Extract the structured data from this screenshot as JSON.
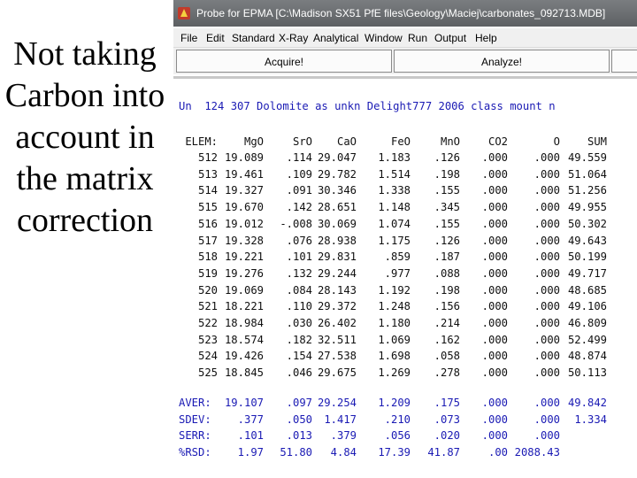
{
  "caption": "Not taking Carbon into account in the matrix correction",
  "window": {
    "title": "Probe for EPMA [C:\\Madison SX51 PfE files\\Geology\\Maciej\\carbonates_092713.MDB]"
  },
  "menu": [
    "File",
    "Edit",
    "Standard",
    "X-Ray",
    "Analytical",
    "Window",
    "Run",
    "Output",
    "Help"
  ],
  "toolbar": {
    "acquire_label": "Acquire!",
    "analyze_label": "Analyze!"
  },
  "log": {
    "header_line": "Un  124 307 Dolomite as unkn Delight777 2006 class mount n",
    "columns": [
      "ELEM:",
      "MgO",
      "SrO",
      "CaO",
      "FeO",
      "MnO",
      "CO2",
      "O",
      "SUM"
    ],
    "rows": [
      [
        "512",
        "19.089",
        ".114",
        "29.047",
        "1.183",
        ".126",
        ".000",
        ".000",
        "49.559"
      ],
      [
        "513",
        "19.461",
        ".109",
        "29.782",
        "1.514",
        ".198",
        ".000",
        ".000",
        "51.064"
      ],
      [
        "514",
        "19.327",
        ".091",
        "30.346",
        "1.338",
        ".155",
        ".000",
        ".000",
        "51.256"
      ],
      [
        "515",
        "19.670",
        ".142",
        "28.651",
        "1.148",
        ".345",
        ".000",
        ".000",
        "49.955"
      ],
      [
        "516",
        "19.012",
        "-.008",
        "30.069",
        "1.074",
        ".155",
        ".000",
        ".000",
        "50.302"
      ],
      [
        "517",
        "19.328",
        ".076",
        "28.938",
        "1.175",
        ".126",
        ".000",
        ".000",
        "49.643"
      ],
      [
        "518",
        "19.221",
        ".101",
        "29.831",
        ".859",
        ".187",
        ".000",
        ".000",
        "50.199"
      ],
      [
        "519",
        "19.276",
        ".132",
        "29.244",
        ".977",
        ".088",
        ".000",
        ".000",
        "49.717"
      ],
      [
        "520",
        "19.069",
        ".084",
        "28.143",
        "1.192",
        ".198",
        ".000",
        ".000",
        "48.685"
      ],
      [
        "521",
        "18.221",
        ".110",
        "29.372",
        "1.248",
        ".156",
        ".000",
        ".000",
        "49.106"
      ],
      [
        "522",
        "18.984",
        ".030",
        "26.402",
        "1.180",
        ".214",
        ".000",
        ".000",
        "46.809"
      ],
      [
        "523",
        "18.574",
        ".182",
        "32.511",
        "1.069",
        ".162",
        ".000",
        ".000",
        "52.499"
      ],
      [
        "524",
        "19.426",
        ".154",
        "27.538",
        "1.698",
        ".058",
        ".000",
        ".000",
        "48.874"
      ],
      [
        "525",
        "18.845",
        ".046",
        "29.675",
        "1.269",
        ".278",
        ".000",
        ".000",
        "50.113"
      ]
    ],
    "stats": [
      {
        "label": "AVER:",
        "values": [
          "19.107",
          ".097",
          "29.254",
          "1.209",
          ".175",
          ".000",
          ".000",
          "49.842"
        ]
      },
      {
        "label": "SDEV:",
        "values": [
          ".377",
          ".050",
          "1.417",
          ".210",
          ".073",
          ".000",
          ".000",
          "1.334"
        ]
      },
      {
        "label": "SERR:",
        "values": [
          ".101",
          ".013",
          ".379",
          ".056",
          ".020",
          ".000",
          ".000",
          ""
        ]
      },
      {
        "label": "%RSD:",
        "values": [
          "1.97",
          "51.80",
          "4.84",
          "17.39",
          "41.87",
          ".00",
          "2088.43",
          ""
        ]
      }
    ]
  }
}
